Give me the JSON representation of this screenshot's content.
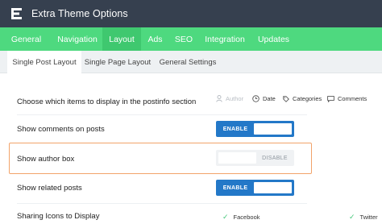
{
  "app": {
    "title": "Extra Theme Options",
    "logo_letter": "E"
  },
  "main_nav": {
    "items": [
      {
        "label": "General"
      },
      {
        "label": "Navigation"
      },
      {
        "label": "Layout",
        "active": true
      },
      {
        "label": "Ads"
      },
      {
        "label": "SEO"
      },
      {
        "label": "Integration"
      },
      {
        "label": "Updates"
      }
    ]
  },
  "sub_nav": {
    "items": [
      {
        "label": "Single Post Layout",
        "active": true
      },
      {
        "label": "Single Page Layout"
      },
      {
        "label": "General Settings"
      }
    ]
  },
  "settings": {
    "postinfo": {
      "label": "Choose which items to display in the postinfo section",
      "items": [
        {
          "label": "Author",
          "icon": "user-icon",
          "enabled": false
        },
        {
          "label": "Date",
          "icon": "clock-icon",
          "enabled": true
        },
        {
          "label": "Categories",
          "icon": "tag-icon",
          "enabled": true
        },
        {
          "label": "Comments",
          "icon": "comment-icon",
          "enabled": true
        }
      ]
    },
    "show_comments": {
      "label": "Show comments on posts",
      "state_label": "ENABLE",
      "on": true
    },
    "show_author_box": {
      "label": "Show author box",
      "state_label": "DISABLE",
      "on": false
    },
    "show_related": {
      "label": "Show related posts",
      "state_label": "ENABLE",
      "on": true
    },
    "sharing": {
      "label": "Sharing Icons to Display",
      "items": [
        {
          "label": "Facebook",
          "checked": true
        },
        {
          "label": "Twitter",
          "checked": true
        }
      ]
    }
  },
  "colors": {
    "titlebar": "#36404f",
    "nav_green": "#4ed97f",
    "nav_active": "#3fc86f",
    "toggle_blue": "#2378c8",
    "highlight_orange": "#f2a36a"
  }
}
